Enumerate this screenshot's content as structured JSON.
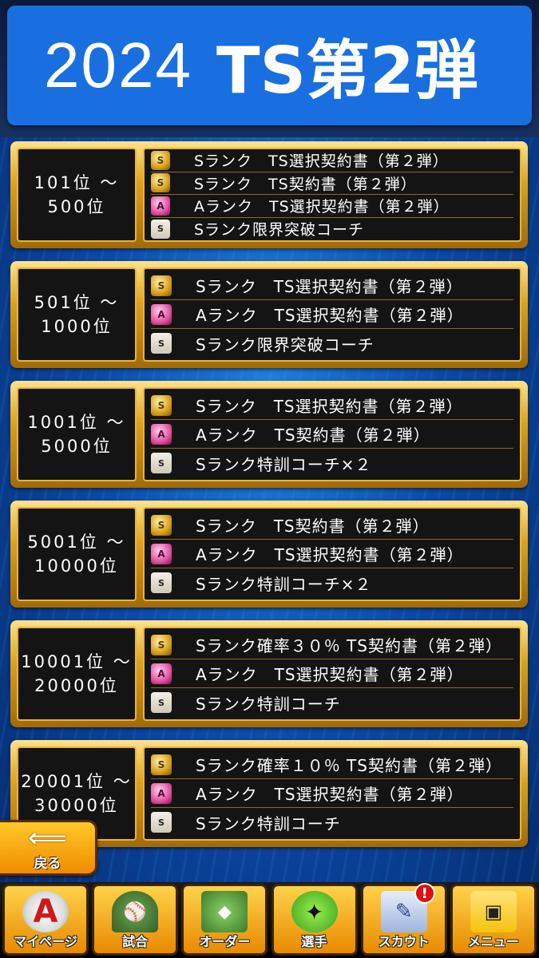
{
  "title": {
    "year": "2024",
    "event": "TS第2弾"
  },
  "tiers": [
    {
      "rank_line1": "101位 ～",
      "rank_line2": "500位",
      "rewards": [
        {
          "icon": "gold-contract-icon",
          "text": "Sランク　TS選択契約書（第２弾）"
        },
        {
          "icon": "gold-contract-icon",
          "text": "Sランク　TS契約書（第２弾）"
        },
        {
          "icon": "pink-contract-icon",
          "text": "Aランク　TS選択契約書（第２弾）"
        },
        {
          "icon": "coach-icon",
          "text": "Sランク限界突破コーチ"
        }
      ]
    },
    {
      "rank_line1": "501位 ～",
      "rank_line2": "1000位",
      "rewards": [
        {
          "icon": "gold-contract-icon",
          "text": "Sランク　TS選択契約書（第２弾）"
        },
        {
          "icon": "pink-contract-icon",
          "text": "Aランク　TS選択契約書（第２弾）"
        },
        {
          "icon": "coach-icon",
          "text": "Sランク限界突破コーチ"
        }
      ]
    },
    {
      "rank_line1": "1001位 ～",
      "rank_line2": "5000位",
      "rewards": [
        {
          "icon": "gold-contract-icon",
          "text": "Sランク　TS選択契約書（第２弾）"
        },
        {
          "icon": "pink-contract-icon",
          "text": "Aランク　TS契約書（第２弾）"
        },
        {
          "icon": "coach-icon",
          "text": "Sランク特訓コーチ×２"
        }
      ]
    },
    {
      "rank_line1": "5001位 ～",
      "rank_line2": "10000位",
      "rewards": [
        {
          "icon": "gold-contract-icon",
          "text": "Sランク　TS契約書（第２弾）"
        },
        {
          "icon": "pink-contract-icon",
          "text": "Aランク　TS選択契約書（第２弾）"
        },
        {
          "icon": "coach-icon",
          "text": "Sランク特訓コーチ×２"
        }
      ]
    },
    {
      "rank_line1": "10001位 ～",
      "rank_line2": "20000位",
      "rewards": [
        {
          "icon": "gold-contract-icon",
          "text": "Sランク確率３０％ TS契約書（第２弾）"
        },
        {
          "icon": "pink-contract-icon",
          "text": "Aランク　TS選択契約書（第２弾）"
        },
        {
          "icon": "coach-icon",
          "text": "Sランク特訓コーチ"
        }
      ]
    },
    {
      "rank_line1": "20001位 ～",
      "rank_line2": "30000位",
      "rewards": [
        {
          "icon": "gold-contract-icon",
          "text": "Sランク確率１０％ TS契約書（第２弾）"
        },
        {
          "icon": "pink-contract-icon",
          "text": "Aランク　TS選択契約書（第２弾）"
        },
        {
          "icon": "coach-icon",
          "text": "Sランク特訓コーチ"
        }
      ]
    }
  ],
  "back_button": {
    "label": "戻る",
    "icon": "left-arrow-icon"
  },
  "nav": [
    {
      "id": "mypage",
      "label": "マイページ",
      "icon": "mypage-icon",
      "glyph": "A"
    },
    {
      "id": "game",
      "label": "試合",
      "icon": "stadium-icon",
      "glyph": "⚾"
    },
    {
      "id": "order",
      "label": "オーダー",
      "icon": "field-icon",
      "glyph": "◆"
    },
    {
      "id": "player",
      "label": "選手",
      "icon": "player-icon",
      "glyph": "✦"
    },
    {
      "id": "scout",
      "label": "スカウト",
      "icon": "scout-icon",
      "glyph": "✎",
      "badge": "!"
    },
    {
      "id": "menu",
      "label": "メニュー",
      "icon": "menu-icon",
      "glyph": "▣"
    }
  ],
  "colors": {
    "banner": "#1a6fe0",
    "gold_frame": "#d9a21c",
    "panel": "#141414"
  }
}
